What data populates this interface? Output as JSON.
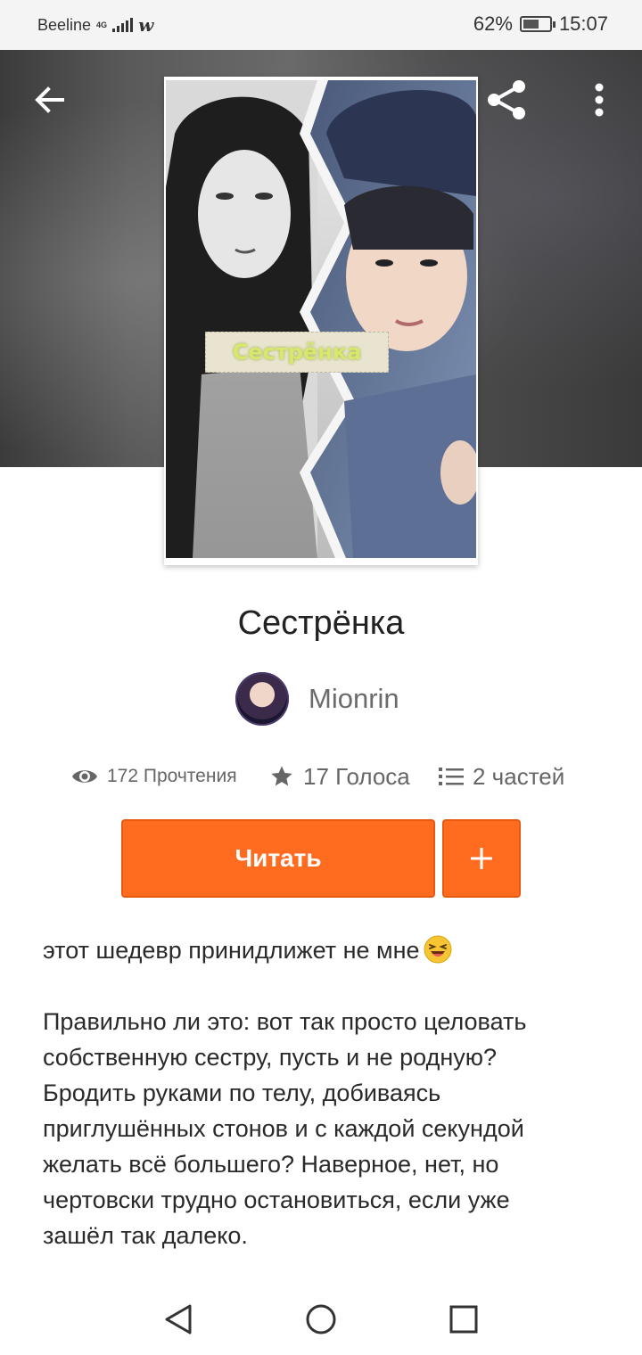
{
  "status_bar": {
    "carrier": "Beeline",
    "network": "4G",
    "battery": "62%",
    "battery_level": 0.62,
    "time": "15:07"
  },
  "header": {
    "back_icon": "arrow-left-icon",
    "share_icon": "share-icon",
    "more_icon": "more-vertical-icon"
  },
  "story": {
    "cover_text": "Сестрёнка",
    "title": "Сестрёнка",
    "author": "Mionrin",
    "stats": {
      "reads": "172 Прочтения",
      "votes": "17 Голоса",
      "parts": "2 частей"
    },
    "read_button": "Читать",
    "description_line1": "этот шедевр принидлижет не мне",
    "description_para2": [
      "Правильно ли это: вот так просто целовать",
      "собственную сестру, пусть и не родную?",
      "Бродить руками по телу, добиваясь",
      "приглушённых стонов и с каждой секундой",
      "желать всё большего? Наверное, нет, но",
      "чертовски трудно остановиться, если уже",
      "зашёл так далеко."
    ]
  },
  "colors": {
    "accent": "#ff6b1f",
    "text_dark": "#222222",
    "text_muted": "#666666"
  }
}
